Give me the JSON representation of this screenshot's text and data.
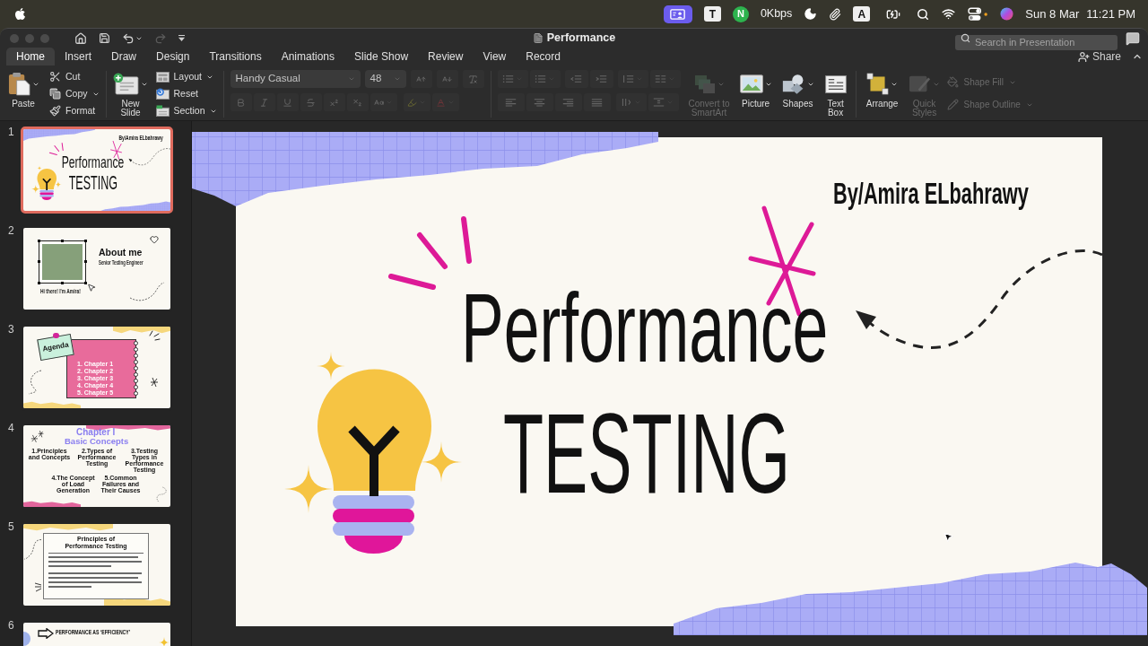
{
  "menu_bar": {
    "items": [
      {
        "kind": "screen-share"
      },
      {
        "kind": "tile",
        "text": "T"
      },
      {
        "kind": "badge",
        "text": "N"
      },
      {
        "kind": "speed",
        "text": "0Kbps"
      },
      {
        "kind": "moon"
      },
      {
        "kind": "clip"
      },
      {
        "kind": "tile",
        "text": "A"
      },
      {
        "kind": "battery"
      },
      {
        "kind": "search"
      },
      {
        "kind": "wifi"
      },
      {
        "kind": "control-center"
      },
      {
        "kind": "siri"
      },
      {
        "kind": "date",
        "text": "Sun 8 Mar"
      },
      {
        "kind": "time",
        "text": "11:21 PM"
      }
    ]
  },
  "window": {
    "title": "Performance",
    "search_placeholder": "Search in Presentation"
  },
  "quick_access": [
    {
      "kind": "home",
      "disabled": false
    },
    {
      "kind": "save",
      "disabled": false
    },
    {
      "kind": "undo",
      "disabled": false
    },
    {
      "kind": "redo",
      "disabled": true
    },
    {
      "kind": "customize",
      "disabled": false
    }
  ],
  "tabs": [
    {
      "label": "Home",
      "selected": true
    },
    {
      "label": "Insert",
      "selected": false
    },
    {
      "label": "Draw",
      "selected": false
    },
    {
      "label": "Design",
      "selected": false
    },
    {
      "label": "Transitions",
      "selected": false
    },
    {
      "label": "Animations",
      "selected": false
    },
    {
      "label": "Slide Show",
      "selected": false
    },
    {
      "label": "Review",
      "selected": false
    },
    {
      "label": "View",
      "selected": false
    },
    {
      "label": "Record",
      "selected": false
    }
  ],
  "share": {
    "label": "Share"
  },
  "ribbon": {
    "paste": {
      "label": "Paste"
    },
    "clipboard_actions": [
      {
        "kind": "cut",
        "label": "Cut",
        "has_menu": false
      },
      {
        "kind": "copy",
        "label": "Copy",
        "has_menu": true
      },
      {
        "kind": "format",
        "label": "Format",
        "has_menu": false
      }
    ],
    "new_slide": {
      "label": "New Slide"
    },
    "slide_actions": [
      {
        "kind": "layout",
        "label": "Layout",
        "has_menu": true
      },
      {
        "kind": "reset",
        "label": "Reset",
        "has_menu": false
      },
      {
        "kind": "section",
        "label": "Section",
        "has_menu": true
      }
    ],
    "font": {
      "name": "Handy Casual",
      "size": "48",
      "formatting_disabled": true
    },
    "paragraph": {
      "disabled": true
    },
    "insert_actions": [
      {
        "kind": "smartart",
        "label": "Convert to SmartArt",
        "disabled": true,
        "has_menu": true
      },
      {
        "kind": "picture",
        "label": "Picture",
        "disabled": false,
        "has_menu": true
      },
      {
        "kind": "shapes",
        "label": "Shapes",
        "disabled": false,
        "has_menu": true
      },
      {
        "kind": "textbox",
        "label": "Text Box",
        "disabled": false,
        "has_menu": false
      }
    ],
    "drawing_actions": [
      {
        "kind": "arrange",
        "label": "Arrange",
        "disabled": false,
        "has_menu": true
      },
      {
        "kind": "quick-styles",
        "label": "Quick Styles",
        "disabled": true,
        "has_menu": true
      }
    ],
    "shape_format": [
      {
        "kind": "fill",
        "label": "Shape Fill",
        "disabled": true
      },
      {
        "kind": "outline",
        "label": "Shape Outline",
        "disabled": true
      }
    ]
  },
  "slides_pane": [
    {
      "number": "1",
      "selected": true,
      "kind": "title",
      "author": "By/Amira ELbahrawy",
      "title_line_1": "Performance",
      "title_line_2": "TESTING"
    },
    {
      "number": "2",
      "selected": false,
      "kind": "about",
      "heading": "About me",
      "subtitle": "Senior Testing Engineer",
      "caption": "Hi there! I'm Amira!"
    },
    {
      "number": "3",
      "selected": false,
      "kind": "agenda",
      "heading": "Agenda",
      "items": [
        "1. Chapter 1",
        "2. Chapter 2",
        "3. Chapter 3",
        "4. Chapter 4",
        "5. Chapter 5"
      ]
    },
    {
      "number": "4",
      "selected": false,
      "kind": "chapter",
      "heading": "Chapter I",
      "subtitle": "Basic Concepts",
      "items": [
        "1.Principles and Concepts",
        "2.Types of Performance Testing",
        "3.Testing Types in Performance Testing",
        "4.The Concept of Load Generation",
        "5.Common Failures and Their Causes"
      ]
    },
    {
      "number": "5",
      "selected": false,
      "kind": "text",
      "heading": "Principles of Performance Testing"
    },
    {
      "number": "6",
      "selected": false,
      "kind": "banner",
      "heading": "PERFORMANCE AS ‘EFFICIENCY’"
    }
  ],
  "slide": {
    "author": "By/Amira ELbahrawy",
    "title_line_1": "Performance",
    "title_line_2": "TESTING"
  }
}
